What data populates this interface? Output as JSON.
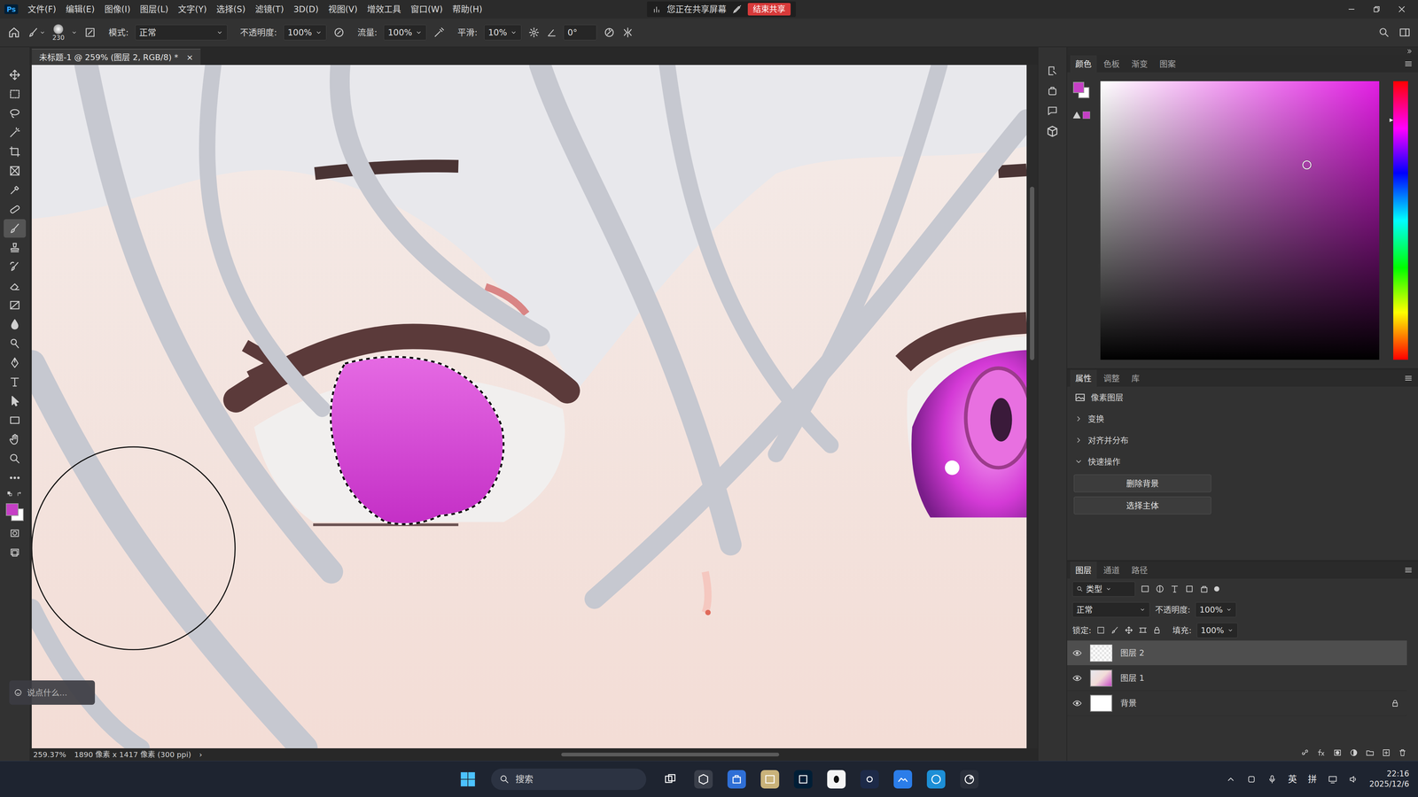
{
  "menu_bar": {
    "app": "Ps",
    "menus": [
      "文件(F)",
      "编辑(E)",
      "图像(I)",
      "图层(L)",
      "文字(Y)",
      "选择(S)",
      "滤镜(T)",
      "3D(D)",
      "视图(V)",
      "增效工具",
      "窗口(W)",
      "帮助(H)"
    ],
    "sharing_notice": "您正在共享屏幕",
    "stop_sharing": "结束共享"
  },
  "options_bar": {
    "brush_size": "230",
    "mode_label": "模式:",
    "mode": "正常",
    "opacity_label": "不透明度:",
    "opacity": "100%",
    "flow_label": "流量:",
    "flow": "100%",
    "smoothing_label": "平滑:",
    "smoothing": "10%",
    "angle": "0°"
  },
  "document_tab": {
    "title": "未标题-1 @ 259% (图层 2, RGB/8) *",
    "close": "×"
  },
  "toolbar": {
    "tools": [
      {
        "kind": "move",
        "selected": false
      },
      {
        "kind": "marquee",
        "selected": false
      },
      {
        "kind": "lasso",
        "selected": false
      },
      {
        "kind": "wand",
        "selected": false
      },
      {
        "kind": "crop",
        "selected": false
      },
      {
        "kind": "frame",
        "selected": false
      },
      {
        "kind": "eyedropper",
        "selected": false
      },
      {
        "kind": "healing",
        "selected": false
      },
      {
        "kind": "brush",
        "selected": true
      },
      {
        "kind": "stamp",
        "selected": false
      },
      {
        "kind": "history",
        "selected": false
      },
      {
        "kind": "eraser",
        "selected": false
      },
      {
        "kind": "gradient",
        "selected": false
      },
      {
        "kind": "blur",
        "selected": false
      },
      {
        "kind": "dodge",
        "selected": false
      },
      {
        "kind": "pen",
        "selected": false
      },
      {
        "kind": "type",
        "selected": false
      },
      {
        "kind": "pathselect",
        "selected": false
      },
      {
        "kind": "rectangle",
        "selected": false
      },
      {
        "kind": "hand",
        "selected": false
      },
      {
        "kind": "zoom",
        "selected": false
      },
      {
        "kind": "more",
        "selected": false
      }
    ],
    "swatches": [
      {
        "kind": "foreground",
        "color": "#c63fc6"
      },
      {
        "kind": "background",
        "color": "#ffffff"
      }
    ]
  },
  "status_bar": {
    "zoom": "259.37%",
    "info": "1890 像素 x 1417 像素 (300 ppi)",
    "arrow": "›"
  },
  "chat": {
    "placeholder": "说点什么..."
  },
  "color_panel": {
    "tabs": [
      {
        "label": "颜色",
        "selected": true
      },
      {
        "label": "色板",
        "selected": false
      },
      {
        "label": "渐变",
        "selected": false
      },
      {
        "label": "图案",
        "selected": false
      }
    ],
    "saturation": 0.74,
    "brightness": 0.7,
    "hue_level": 0.14
  },
  "properties_panel": {
    "tabs": [
      {
        "label": "属性",
        "selected": true
      },
      {
        "label": "调整",
        "selected": false
      },
      {
        "label": "库",
        "selected": false
      }
    ],
    "layer_type": "像素图层",
    "sections": [
      {
        "label": "变换",
        "expanded": false
      },
      {
        "label": "对齐并分布",
        "expanded": false
      },
      {
        "label": "快速操作",
        "expanded": true
      }
    ],
    "buttons": [
      "删除背景",
      "选择主体"
    ]
  },
  "layers_panel": {
    "tabs": [
      {
        "label": "图层",
        "selected": true
      },
      {
        "label": "通道",
        "selected": false
      },
      {
        "label": "路径",
        "selected": false
      }
    ],
    "filter": "类型",
    "blend_mode": "正常",
    "opacity_label": "不透明度:",
    "opacity": "100%",
    "lock_label": "锁定:",
    "fill_label": "填充:",
    "fill": "100%",
    "layers": [
      {
        "name": "图层 2",
        "visible": true,
        "selected": true,
        "locked": false,
        "kind": "transparent"
      },
      {
        "name": "图层 1",
        "visible": true,
        "selected": false,
        "locked": false,
        "kind": "image"
      },
      {
        "name": "背景",
        "visible": true,
        "selected": false,
        "locked": true,
        "kind": "white"
      }
    ]
  },
  "taskbar": {
    "search": "搜索",
    "ime": [
      "英",
      "拼"
    ],
    "time": "22:16",
    "date": "2025/12/6"
  }
}
